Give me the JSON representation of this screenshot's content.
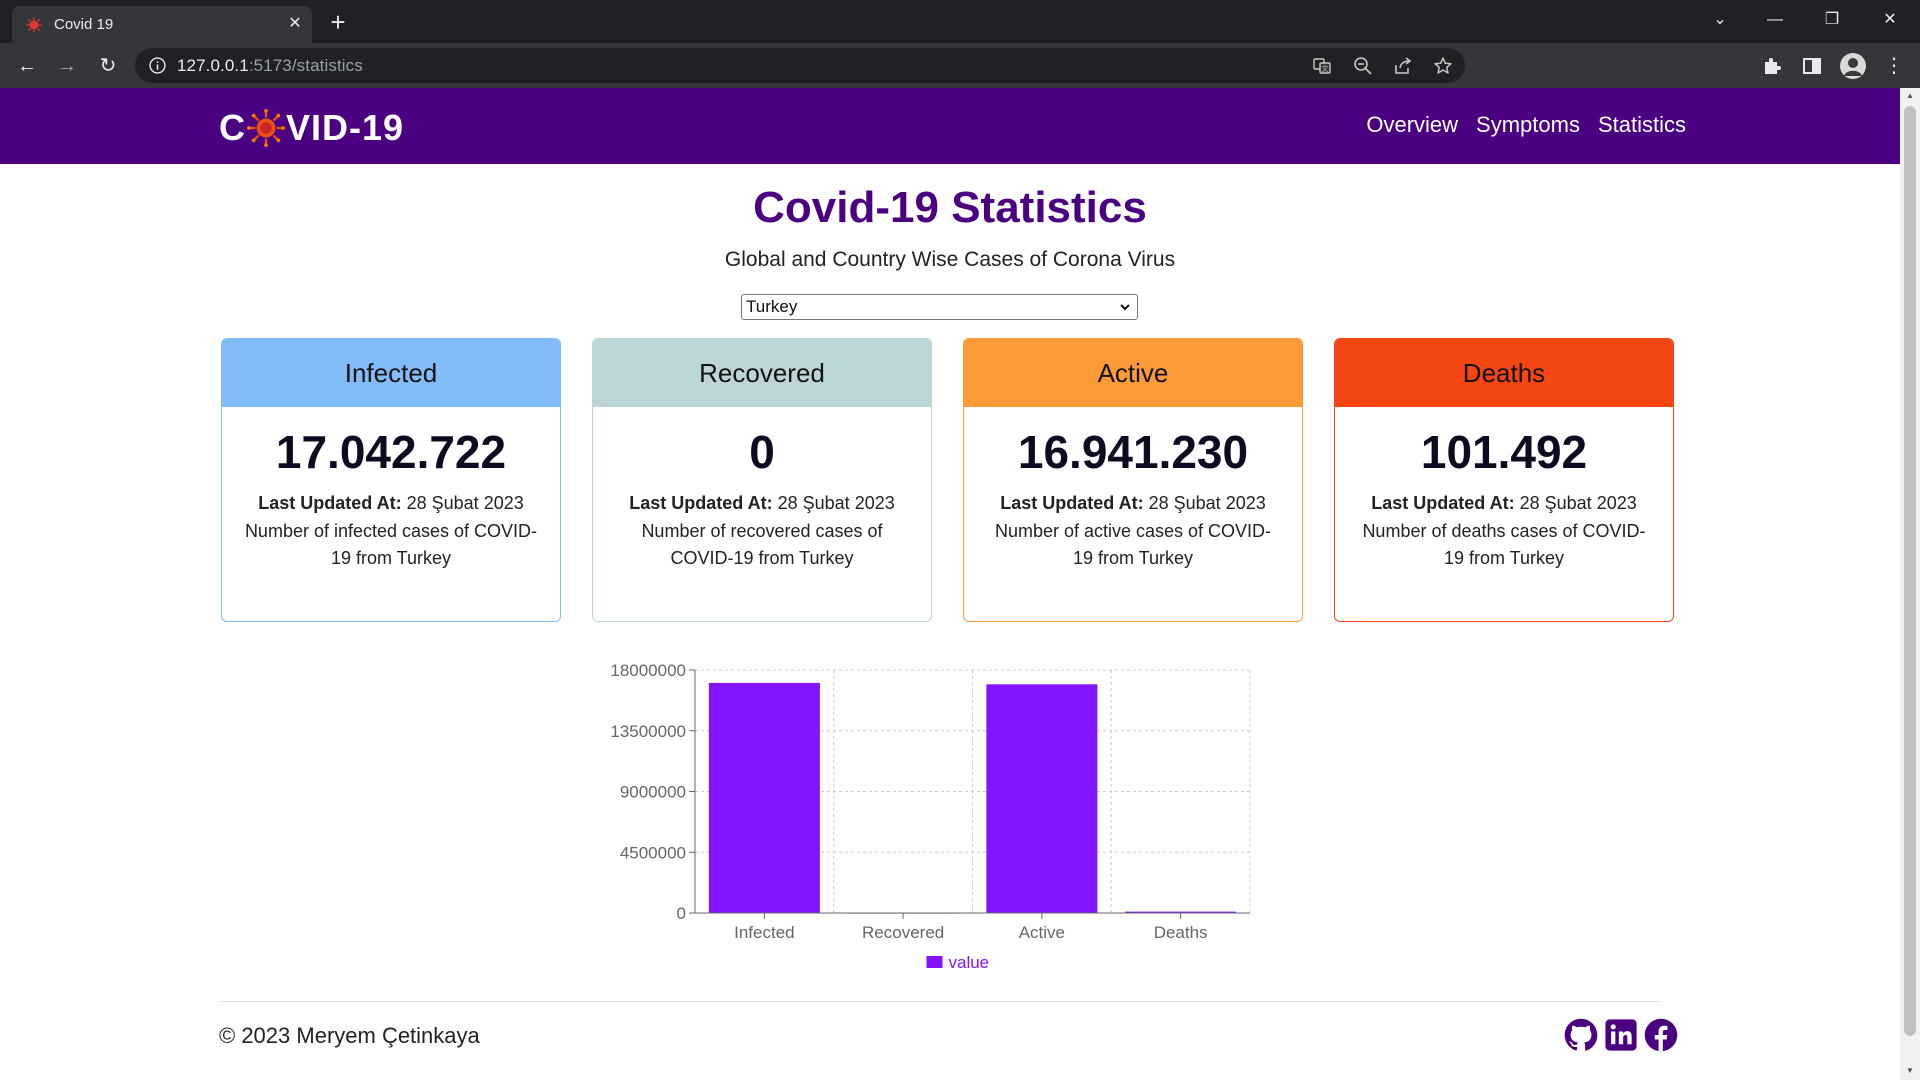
{
  "browser": {
    "tab_title": "Covid 19",
    "url_host": "127.0.0.1",
    "url_rest": ":5173/statistics"
  },
  "navbar": {
    "logo_left": "C",
    "logo_right": "VID-19",
    "links": [
      "Overview",
      "Symptoms",
      "Statistics"
    ]
  },
  "header": {
    "title": "Covid-19 Statistics",
    "subtitle": "Global and Country Wise Cases of Corona Virus"
  },
  "country_select": {
    "value": "Turkey"
  },
  "cards": [
    {
      "title": "Infected",
      "value": "17.042.722",
      "updated_label": "Last Updated At:",
      "updated_date": "28 Şubat 2023",
      "desc": "Number of infected cases of COVID-19 from Turkey",
      "head_color": "#82bcf8",
      "border_color": "#82bcf8"
    },
    {
      "title": "Recovered",
      "value": "0",
      "updated_label": "Last Updated At:",
      "updated_date": "28 Şubat 2023",
      "desc": "Number of recovered cases of COVID-19 from Turkey",
      "head_color": "#bcd6d8",
      "border_color": "#bcd6d8"
    },
    {
      "title": "Active",
      "value": "16.941.230",
      "updated_label": "Last Updated At:",
      "updated_date": "28 Şubat 2023",
      "desc": "Number of active cases of COVID-19 from Turkey",
      "head_color": "#fd9a38",
      "border_color": "#fd9a38"
    },
    {
      "title": "Deaths",
      "value": "101.492",
      "updated_label": "Last Updated At:",
      "updated_date": "28 Şubat 2023",
      "desc": "Number of deaths cases of COVID-19 from Turkey",
      "head_color": "#f44612",
      "border_color": "#f44612"
    }
  ],
  "chart_data": {
    "type": "bar",
    "categories": [
      "Infected",
      "Recovered",
      "Active",
      "Deaths"
    ],
    "series": [
      {
        "name": "value",
        "values": [
          17042722,
          0,
          16941230,
          101492
        ],
        "color": "#8214ff"
      }
    ],
    "yticks": [
      0,
      4500000,
      9000000,
      13500000,
      18000000
    ],
    "ylim": [
      0,
      18000000
    ],
    "grid": true,
    "legend": "bottom"
  },
  "footer": {
    "copyright": "© 2023 Meryem Çetinkaya",
    "socials": [
      "github-icon",
      "linkedin-icon",
      "facebook-icon"
    ]
  }
}
